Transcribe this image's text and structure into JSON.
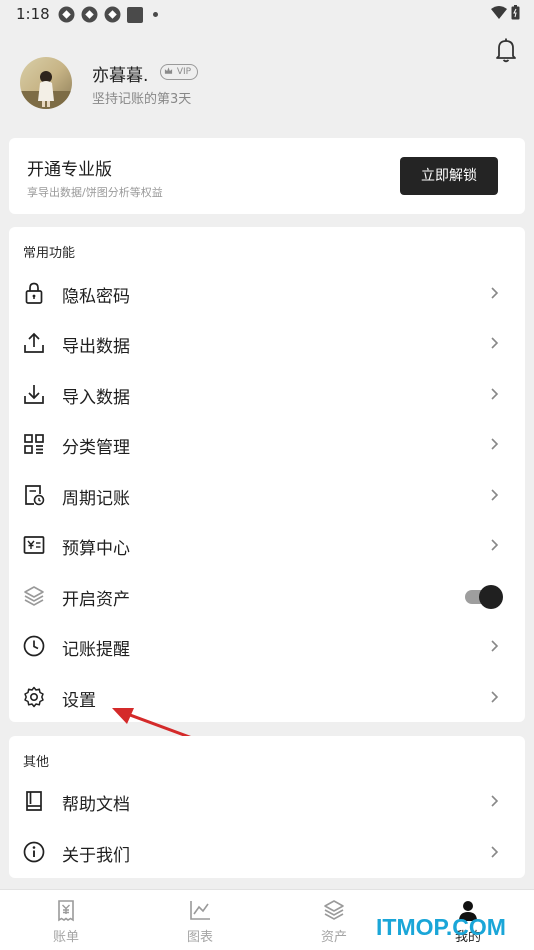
{
  "status_bar": {
    "time": "1:18"
  },
  "profile": {
    "username": "亦暮暮.",
    "vip_badge": "VIP",
    "streak": "坚持记账的第3天"
  },
  "pro_card": {
    "title": "开通专业版",
    "subtitle": "享导出数据/饼图分析等权益",
    "unlock_label": "立即解锁"
  },
  "common_section": {
    "title": "常用功能",
    "items": [
      {
        "label": "隐私密码",
        "icon": "lock-icon"
      },
      {
        "label": "导出数据",
        "icon": "upload-icon"
      },
      {
        "label": "导入数据",
        "icon": "download-icon"
      },
      {
        "label": "分类管理",
        "icon": "grid-icon"
      },
      {
        "label": "周期记账",
        "icon": "calendar-clock-icon"
      },
      {
        "label": "预算中心",
        "icon": "budget-icon"
      },
      {
        "label": "开启资产",
        "icon": "layers-icon",
        "toggle": true
      },
      {
        "label": "记账提醒",
        "icon": "clock-icon"
      },
      {
        "label": "设置",
        "icon": "gear-icon"
      }
    ]
  },
  "other_section": {
    "title": "其他",
    "items": [
      {
        "label": "帮助文档",
        "icon": "book-icon"
      },
      {
        "label": "关于我们",
        "icon": "info-icon"
      }
    ]
  },
  "bottom_nav": {
    "items": [
      {
        "label": "账单",
        "icon": "receipt-icon"
      },
      {
        "label": "图表",
        "icon": "chart-icon"
      },
      {
        "label": "资产",
        "icon": "layers-icon"
      },
      {
        "label": "我的",
        "icon": "person-icon",
        "active": true
      }
    ]
  },
  "watermark": "ITMOP.COM",
  "colors": {
    "accent": "#242424",
    "background": "#efefef",
    "watermark": "#1aa6d8",
    "annotation_arrow": "#d42a2a"
  }
}
